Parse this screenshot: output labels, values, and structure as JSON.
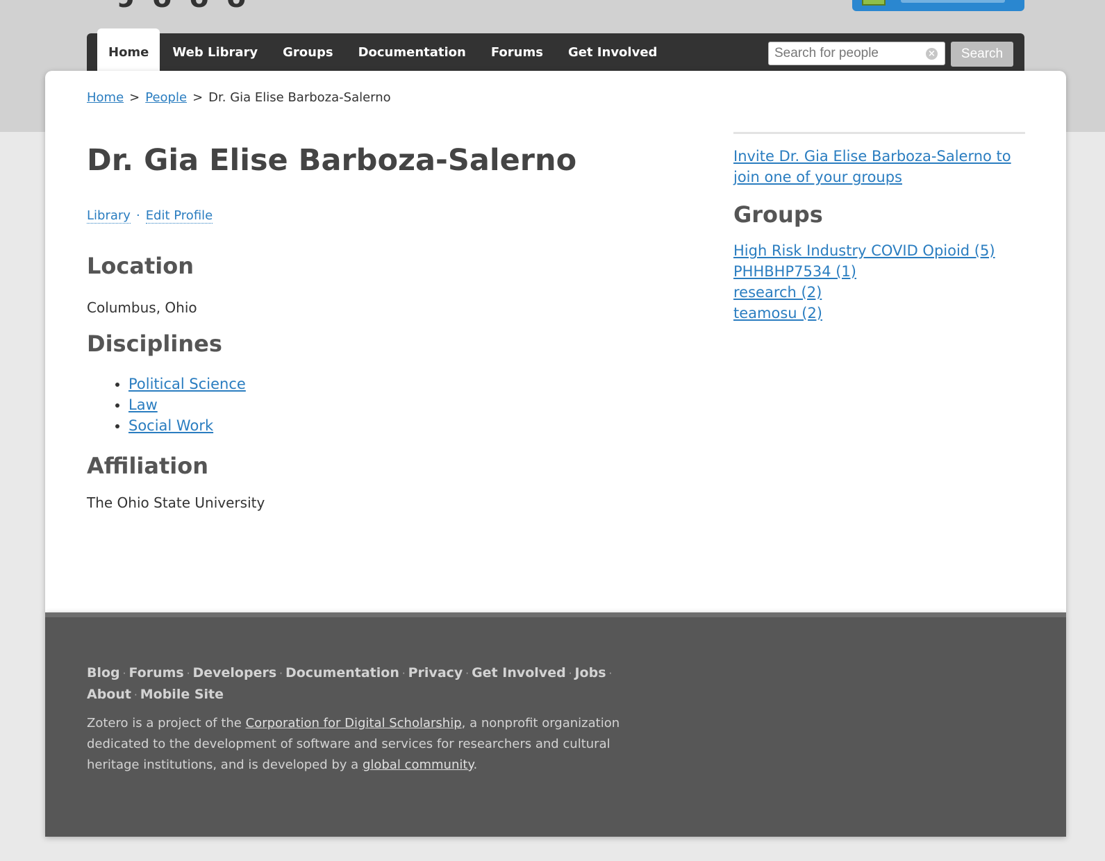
{
  "nav": {
    "items": [
      {
        "label": "Home",
        "active": true
      },
      {
        "label": "Web Library"
      },
      {
        "label": "Groups"
      },
      {
        "label": "Documentation"
      },
      {
        "label": "Forums"
      },
      {
        "label": "Get Involved"
      }
    ],
    "search_placeholder": "Search for people",
    "search_value": "",
    "search_button": "Search"
  },
  "breadcrumb": {
    "home": "Home",
    "people": "People",
    "current": "Dr. Gia Elise Barboza-Salerno",
    "separator": ">"
  },
  "profile": {
    "name": "Dr. Gia Elise Barboza-Salerno",
    "links": {
      "library": "Library",
      "edit": "Edit Profile",
      "separator": "·"
    },
    "location_heading": "Location",
    "location": "Columbus, Ohio",
    "disciplines_heading": "Disciplines",
    "disciplines": [
      "Political Science",
      "Law",
      "Social Work"
    ],
    "affiliation_heading": "Affiliation",
    "affiliation": "The Ohio State University"
  },
  "sidebar": {
    "invite_text": "Invite Dr. Gia Elise Barboza-Salerno to join one of your groups",
    "groups_heading": "Groups",
    "groups": [
      "High Risk Industry COVID Opioid (5)",
      "PHHBHP7534 (1)",
      "research (2)",
      "teamosu (2)"
    ]
  },
  "footer": {
    "links": [
      "Blog",
      "Forums",
      "Developers",
      "Documentation",
      "Privacy",
      "Get Involved",
      "Jobs",
      "About",
      "Mobile Site"
    ],
    "text_before": "Zotero is a project of the ",
    "cds_link": "Corporation for Digital Scholarship",
    "text_middle": ", a nonprofit organization dedicated to the development of software and services for researchers and cultural heritage institutions, and is developed by a ",
    "community_link": "global community",
    "text_after": "."
  },
  "colors": {
    "link": "#2a7dc0",
    "nav_bg": "#333333",
    "footer_bg": "#575757",
    "upgrade_button": "#2a87d0"
  }
}
